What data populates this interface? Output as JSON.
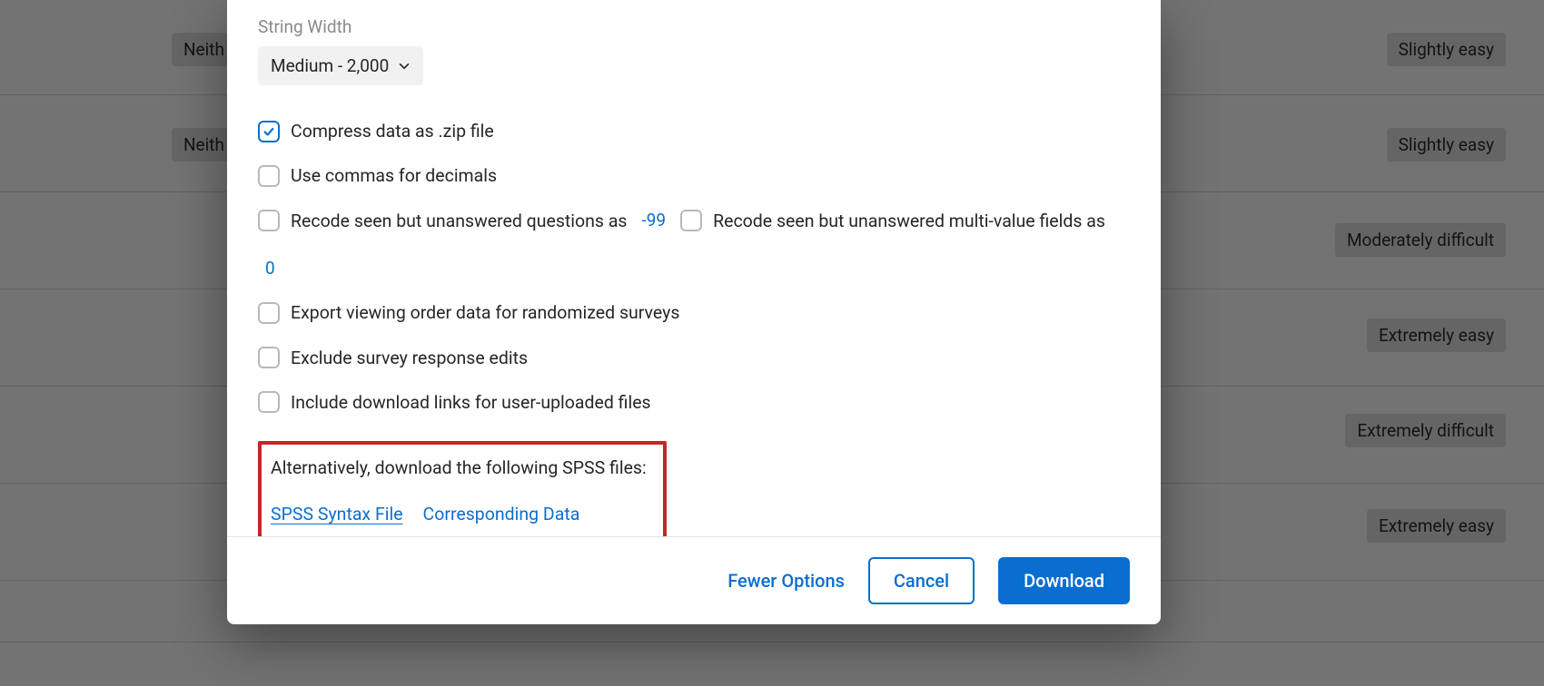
{
  "background": {
    "leftPills": [
      "Neith",
      "Neith"
    ],
    "rightPills": [
      "Slightly easy",
      "Slightly easy",
      "Moderately difficult",
      "Extremely easy",
      "Extremely difficult",
      "Extremely easy"
    ]
  },
  "modal": {
    "stringWidth": {
      "label": "String Width",
      "value": "Medium - 2,000"
    },
    "options": {
      "compress": {
        "label": "Compress data as .zip file",
        "checked": true
      },
      "commas": {
        "label": "Use commas for decimals",
        "checked": false
      },
      "recodeUnanswered": {
        "labelPrefix": "Recode seen but unanswered questions as",
        "value": "-99",
        "checked": false
      },
      "recodeMulti": {
        "labelPrefix": "Recode seen but unanswered multi-value fields as",
        "value": "0",
        "checked": false
      },
      "exportOrder": {
        "label": "Export viewing order data for randomized surveys",
        "checked": false
      },
      "excludeEdits": {
        "label": "Exclude survey response edits",
        "checked": false
      },
      "includeLinks": {
        "label": "Include download links for user-uploaded files",
        "checked": false
      }
    },
    "alt": {
      "intro": "Alternatively, download the following SPSS files:",
      "link1": "SPSS Syntax File",
      "link2": "Corresponding Data"
    },
    "footer": {
      "fewer": "Fewer Options",
      "cancel": "Cancel",
      "download": "Download"
    }
  }
}
